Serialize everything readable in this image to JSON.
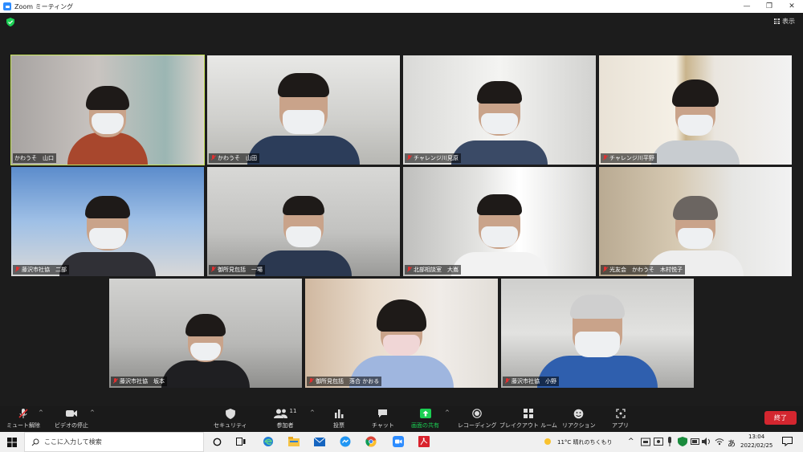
{
  "window": {
    "title": "Zoom ミーティング"
  },
  "meeting": {
    "view_label": "表示"
  },
  "participants": [
    {
      "name": "かわうそ　山口",
      "active": true
    },
    {
      "name": "かわうそ　山田"
    },
    {
      "name": "チャレンジ川見原"
    },
    {
      "name": "チャレンジ川平野"
    },
    {
      "name": "藤沢市社協　二部"
    },
    {
      "name": "御所見包括　一場"
    },
    {
      "name": "北部相談室　大嶌"
    },
    {
      "name": "光友会　かわうそ　木村悦子"
    },
    {
      "name": "藤沢市社協　坂本"
    },
    {
      "name": "御所見包括　落合 かおる"
    },
    {
      "name": "藤沢市社協　小野"
    }
  ],
  "toolbar": {
    "unmute": "ミュート解除",
    "stop_video": "ビデオの停止",
    "security": "セキュリティ",
    "participants": "参加者",
    "participants_count": "11",
    "poll": "投票",
    "chat": "チャット",
    "share": "画面の共有",
    "record": "レコーディング",
    "breakout": "ブレイクアウト ルーム",
    "reactions": "リアクション",
    "apps": "アプリ",
    "end": "終了"
  },
  "taskbar": {
    "search_placeholder": "ここに入力して検索",
    "weather": "11°C  晴れのちくもり",
    "time": "13:04",
    "date": "2022/02/25",
    "ime": "あ"
  },
  "colors": {
    "active_speaker": "#c6e35a",
    "share_green": "#1bcf53",
    "end_red": "#d4262f"
  }
}
